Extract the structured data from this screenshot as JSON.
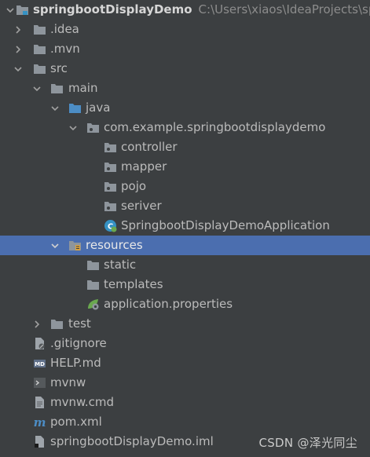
{
  "project": {
    "root_name": "springbootDisplayDemo",
    "root_path": "C:\\Users\\xiaos\\IdeaProjects\\sprin"
  },
  "tree": [
    {
      "label": "springbootDisplayDemo",
      "type": "root",
      "arrow": "down",
      "icon": "module-folder-icon"
    },
    {
      "label": ".idea",
      "type": "folder",
      "arrow": "right",
      "icon": "folder-icon"
    },
    {
      "label": ".mvn",
      "type": "folder",
      "arrow": "right",
      "icon": "folder-icon"
    },
    {
      "label": "src",
      "type": "folder",
      "arrow": "down",
      "icon": "folder-icon"
    },
    {
      "label": "main",
      "type": "folder",
      "arrow": "down",
      "icon": "folder-icon"
    },
    {
      "label": "java",
      "type": "folder",
      "arrow": "down",
      "icon": "source-folder-icon"
    },
    {
      "label": "com.example.springbootdisplaydemo",
      "type": "package",
      "arrow": "down",
      "icon": "package-icon"
    },
    {
      "label": "controller",
      "type": "package",
      "arrow": "none",
      "icon": "package-icon"
    },
    {
      "label": "mapper",
      "type": "package",
      "arrow": "none",
      "icon": "package-icon"
    },
    {
      "label": "pojo",
      "type": "package",
      "arrow": "none",
      "icon": "package-icon"
    },
    {
      "label": "seriver",
      "type": "package",
      "arrow": "none",
      "icon": "package-icon"
    },
    {
      "label": "SpringbootDisplayDemoApplication",
      "type": "class",
      "arrow": "none",
      "icon": "spring-boot-class-icon"
    },
    {
      "label": "resources",
      "type": "folder",
      "arrow": "down",
      "icon": "resources-folder-icon",
      "selected": true
    },
    {
      "label": "static",
      "type": "folder",
      "arrow": "none",
      "icon": "folder-icon"
    },
    {
      "label": "templates",
      "type": "folder",
      "arrow": "none",
      "icon": "folder-icon"
    },
    {
      "label": "application.properties",
      "type": "file",
      "arrow": "none",
      "icon": "spring-properties-icon"
    },
    {
      "label": "test",
      "type": "folder",
      "arrow": "right",
      "icon": "folder-icon"
    },
    {
      "label": ".gitignore",
      "type": "file",
      "arrow": "none",
      "icon": "gitignore-file-icon"
    },
    {
      "label": "HELP.md",
      "type": "file",
      "arrow": "none",
      "icon": "markdown-file-icon"
    },
    {
      "label": "mvnw",
      "type": "file",
      "arrow": "none",
      "icon": "shell-script-icon"
    },
    {
      "label": "mvnw.cmd",
      "type": "file",
      "arrow": "none",
      "icon": "text-file-icon"
    },
    {
      "label": "pom.xml",
      "type": "file",
      "arrow": "none",
      "icon": "maven-icon"
    },
    {
      "label": "springbootDisplayDemo.iml",
      "type": "file",
      "arrow": "none",
      "icon": "iml-file-icon"
    }
  ],
  "watermark": "CSDN @泽光同尘",
  "colors": {
    "background": "#3c3f41",
    "selection": "#4b6eaf",
    "text": "#bbbbbb",
    "folder": "#8e959c",
    "source_folder": "#4c8dc5",
    "spring_green": "#6aa84f"
  }
}
